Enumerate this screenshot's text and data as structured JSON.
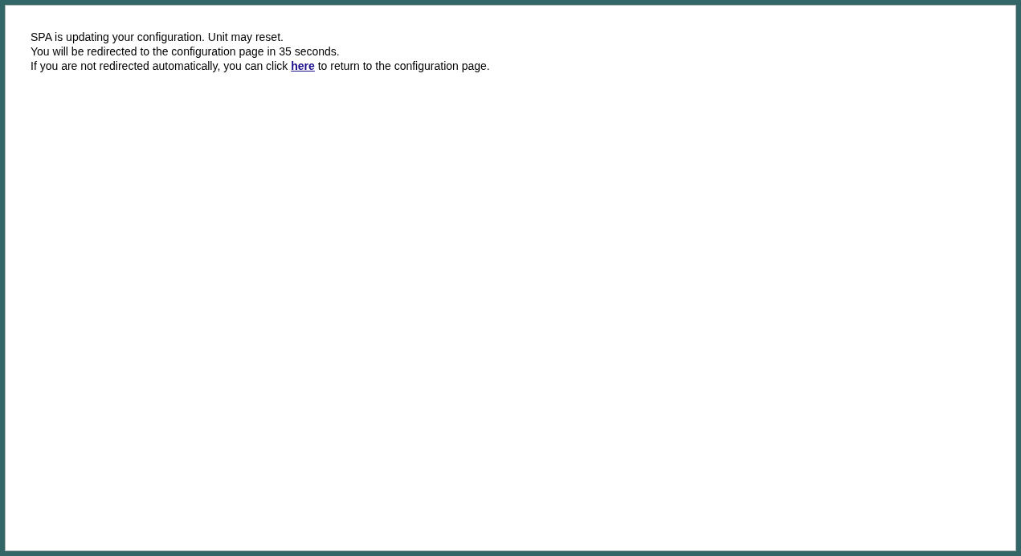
{
  "messages": [
    {
      "text": "SPA is updating your configuration. Unit may reset."
    },
    {
      "text": "You will be redirected to the configuration page in 35 seconds."
    }
  ],
  "fallback": {
    "before": "If you are not redirected automatically, you can click",
    "link": "here",
    "after": "to return to the configuration page."
  }
}
